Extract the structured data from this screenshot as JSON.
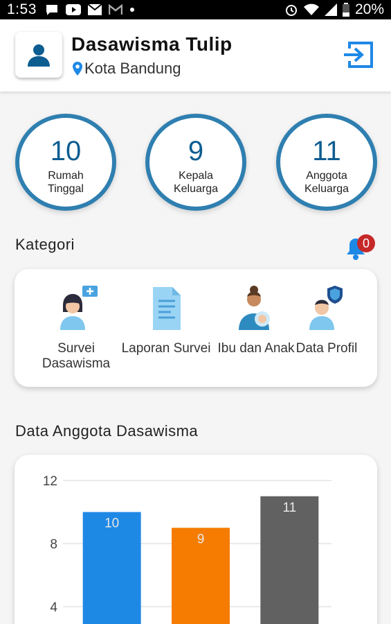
{
  "status_bar": {
    "time": "1:53",
    "battery": "20%"
  },
  "header": {
    "title": "Dasawisma Tulip",
    "location": "Kota Bandung"
  },
  "stats": [
    {
      "value": "10",
      "label": "Rumah Tinggal"
    },
    {
      "value": "9",
      "label": "Kepala Keluarga"
    },
    {
      "value": "11",
      "label": "Anggota Keluarga"
    }
  ],
  "kategori": {
    "title": "Kategori",
    "notification_count": "0",
    "items": [
      {
        "label": "Survei Dasawisma",
        "icon": "survey-woman-icon"
      },
      {
        "label": "Laporan Survei",
        "icon": "document-icon"
      },
      {
        "label": "Ibu dan Anak",
        "icon": "mother-child-icon"
      },
      {
        "label": "Data Profil",
        "icon": "profile-shield-icon"
      }
    ]
  },
  "chart_section": {
    "title": "Data Anggota Dasawisma"
  },
  "chart_data": {
    "type": "bar",
    "categories": [
      "",
      "",
      ""
    ],
    "values": [
      10,
      9,
      11
    ],
    "colors": [
      "#1e88e5",
      "#f57c00",
      "#616161"
    ],
    "yticks": [
      4,
      8,
      12
    ],
    "ylim": [
      0,
      12
    ],
    "title": "",
    "grid": true
  }
}
